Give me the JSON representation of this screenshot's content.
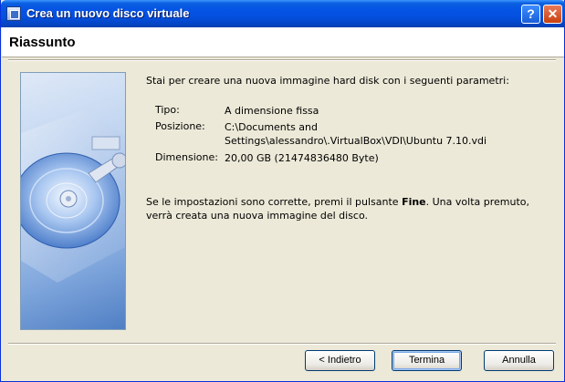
{
  "window": {
    "title": "Crea un nuovo disco virtuale",
    "help_label": "?",
    "close_label": "✕"
  },
  "header": {
    "title": "Riassunto"
  },
  "summary": {
    "intro": "Stai per creare una nuova immagine hard disk con i seguenti parametri:",
    "params": [
      {
        "label": "Tipo:",
        "value": "A dimensione fissa"
      },
      {
        "label": "Posizione:",
        "value": "C:\\Documents and Settings\\alessandro\\.VirtualBox\\VDI\\Ubuntu 7.10.vdi"
      },
      {
        "label": "Dimensione:",
        "value": "20,00 GB (21474836480 Byte)"
      }
    ],
    "closing_before": "Se le impostazioni sono corrette, premi il pulsante ",
    "closing_bold": "Fine",
    "closing_after": ". Una volta premuto, verrà creata una nuova immagine del disco."
  },
  "buttons": {
    "back": "< Indietro",
    "finish": "Termina",
    "cancel": "Annulla"
  }
}
